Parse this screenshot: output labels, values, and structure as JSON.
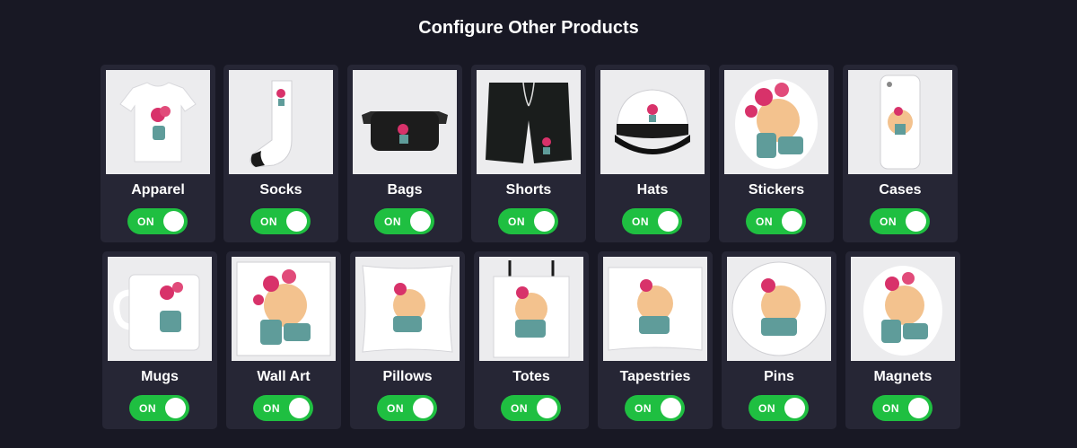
{
  "page": {
    "title": "Configure Other Products"
  },
  "accent": "#1fbf41",
  "products": [
    {
      "label": "Apparel",
      "toggle": "ON",
      "icon": "tshirt-icon"
    },
    {
      "label": "Socks",
      "toggle": "ON",
      "icon": "sock-icon"
    },
    {
      "label": "Bags",
      "toggle": "ON",
      "icon": "bag-icon"
    },
    {
      "label": "Shorts",
      "toggle": "ON",
      "icon": "shorts-icon"
    },
    {
      "label": "Hats",
      "toggle": "ON",
      "icon": "hat-icon"
    },
    {
      "label": "Stickers",
      "toggle": "ON",
      "icon": "sticker-icon"
    },
    {
      "label": "Cases",
      "toggle": "ON",
      "icon": "phone-case-icon"
    },
    {
      "label": "Mugs",
      "toggle": "ON",
      "icon": "mug-icon"
    },
    {
      "label": "Wall Art",
      "toggle": "ON",
      "icon": "wall-art-icon"
    },
    {
      "label": "Pillows",
      "toggle": "ON",
      "icon": "pillow-icon"
    },
    {
      "label": "Totes",
      "toggle": "ON",
      "icon": "tote-icon"
    },
    {
      "label": "Tapestries",
      "toggle": "ON",
      "icon": "tapestry-icon"
    },
    {
      "label": "Pins",
      "toggle": "ON",
      "icon": "pin-icon"
    },
    {
      "label": "Magnets",
      "toggle": "ON",
      "icon": "magnet-icon"
    }
  ]
}
